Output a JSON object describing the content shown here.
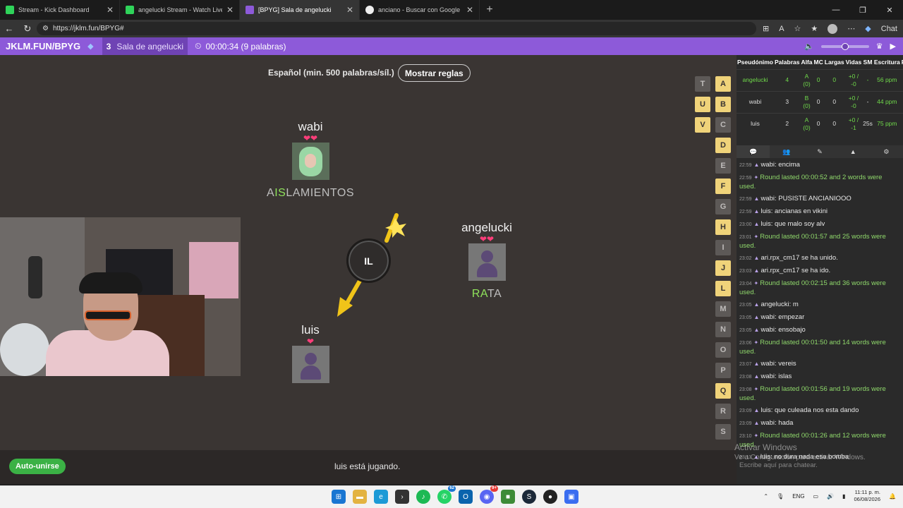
{
  "browser": {
    "tabs": [
      {
        "title": "Stream - Kick Dashboard",
        "color": "#2fd35a"
      },
      {
        "title": "angelucki Stream - Watch Live on Kick",
        "color": "#2fd35a"
      },
      {
        "title": "[BPYG] Sala de angelucki",
        "color": "#8d5ad9"
      },
      {
        "title": "anciano - Buscar con Google",
        "color": "#eeeeee"
      }
    ],
    "url": "https://jklm.fun/BPYG#",
    "chat_label": "Chat"
  },
  "gamebar": {
    "title": "JKLM.FUN/BPYG",
    "player_count": "3",
    "room_name": "Sala de angelucki",
    "timer": "00:00:34 (9 palabras)"
  },
  "board": {
    "language": "Español (min. 500 palabras/síl.)",
    "rules_button": "Mostrar reglas",
    "bomb_syllable": "IL",
    "players": [
      {
        "name": "wabi",
        "hearts": "❤❤",
        "word_pre": "A",
        "word_hl": "IS",
        "word_post": "LAMIENTOS"
      },
      {
        "name": "angelucki",
        "hearts": "❤❤",
        "word_pre": "",
        "word_hl": "RA",
        "word_post": "TA"
      },
      {
        "name": "luis",
        "hearts": "❤",
        "word_pre": "",
        "word_hl": "",
        "word_post": ""
      }
    ],
    "letters_col1": [
      "T",
      "U",
      "V"
    ],
    "letters_col2": [
      "A",
      "B",
      "C",
      "D",
      "E",
      "F",
      "G",
      "H",
      "I",
      "J",
      "L",
      "M",
      "N",
      "O",
      "P",
      "Q",
      "R",
      "S"
    ],
    "used_letters": [
      "U",
      "V",
      "A",
      "B",
      "D",
      "F",
      "H",
      "J",
      "L",
      "Q"
    ]
  },
  "bottom": {
    "autojoin": "Auto-unirse",
    "status": "luis está jugando."
  },
  "scoreboard": {
    "headers": [
      "Pseudónimo",
      "Palabras",
      "Alfa",
      "MC",
      "Largas",
      "Vidas",
      "SM",
      "Escritura",
      "F"
    ],
    "rows": [
      {
        "name": "angelucki",
        "words": "4",
        "alpha": "A (0)",
        "mc": "0",
        "long": "0",
        "lives": "+0 / -0",
        "sm": "-",
        "speed": "56 ppm",
        "highlight": true
      },
      {
        "name": "wabi",
        "words": "3",
        "alpha": "B (0)",
        "mc": "0",
        "long": "0",
        "lives": "+0 / -0",
        "sm": "-",
        "speed": "44 ppm",
        "highlight": false
      },
      {
        "name": "luis",
        "words": "2",
        "alpha": "A (0)",
        "mc": "0",
        "long": "0",
        "lives": "+0 / -1",
        "sm": "25s",
        "speed": "75 ppm",
        "highlight": false
      }
    ]
  },
  "chat": {
    "messages": [
      {
        "time": "22:59",
        "user": "wabi",
        "text": "encima",
        "sys": false
      },
      {
        "time": "22:59",
        "user": "",
        "text": "Round lasted 00:00:52 and 2 words were used.",
        "sys": true
      },
      {
        "time": "22:59",
        "user": "wabi",
        "text": "PUSISTE ANCIANIOOO",
        "sys": false
      },
      {
        "time": "22:59",
        "user": "luis",
        "text": "ancianas en vikini",
        "sys": false
      },
      {
        "time": "23:00",
        "user": "luis",
        "text": "que malo soy alv",
        "sys": false
      },
      {
        "time": "23:01",
        "user": "",
        "text": "Round lasted 00:01:57 and 25 words were used.",
        "sys": true
      },
      {
        "time": "23:02",
        "user": "",
        "text": "ari.rpx_cm17 se ha unido.",
        "sys": false
      },
      {
        "time": "23:03",
        "user": "",
        "text": "ari.rpx_cm17 se ha ido.",
        "sys": false
      },
      {
        "time": "23:04",
        "user": "",
        "text": "Round lasted 00:02:15 and 36 words were used.",
        "sys": true
      },
      {
        "time": "23:05",
        "user": "angelucki",
        "text": "m",
        "sys": false
      },
      {
        "time": "23:05",
        "user": "wabi",
        "text": "empezar",
        "sys": false
      },
      {
        "time": "23:05",
        "user": "wabi",
        "text": "ensobajo",
        "sys": false
      },
      {
        "time": "23:06",
        "user": "",
        "text": "Round lasted 00:01:50 and 14 words were used.",
        "sys": true
      },
      {
        "time": "23:07",
        "user": "wabi",
        "text": "vereis",
        "sys": false
      },
      {
        "time": "23:08",
        "user": "wabi",
        "text": "islas",
        "sys": false
      },
      {
        "time": "23:08",
        "user": "",
        "text": "Round lasted 00:01:56 and 19 words were used.",
        "sys": true
      },
      {
        "time": "23:09",
        "user": "luis",
        "text": "que culeada nos esta dando",
        "sys": false
      },
      {
        "time": "23:09",
        "user": "wabi",
        "text": "hada",
        "sys": false
      },
      {
        "time": "23:10",
        "user": "",
        "text": "Round lasted 00:01:26 and 12 words were used.",
        "sys": true
      },
      {
        "time": "23:11",
        "user": "luis",
        "text": "no dura nada esa bomba",
        "sys": false
      }
    ],
    "input_placeholder": "Escribe aquí para chatear."
  },
  "windows": {
    "activate_title": "Activar Windows",
    "activate_sub": "Ve a Configuración para activar Windows.",
    "lang": "ENG",
    "time": "11:11 p. m.",
    "date": "06/08/2026",
    "whatsapp_badge": "62",
    "discord_badge": "9+"
  }
}
